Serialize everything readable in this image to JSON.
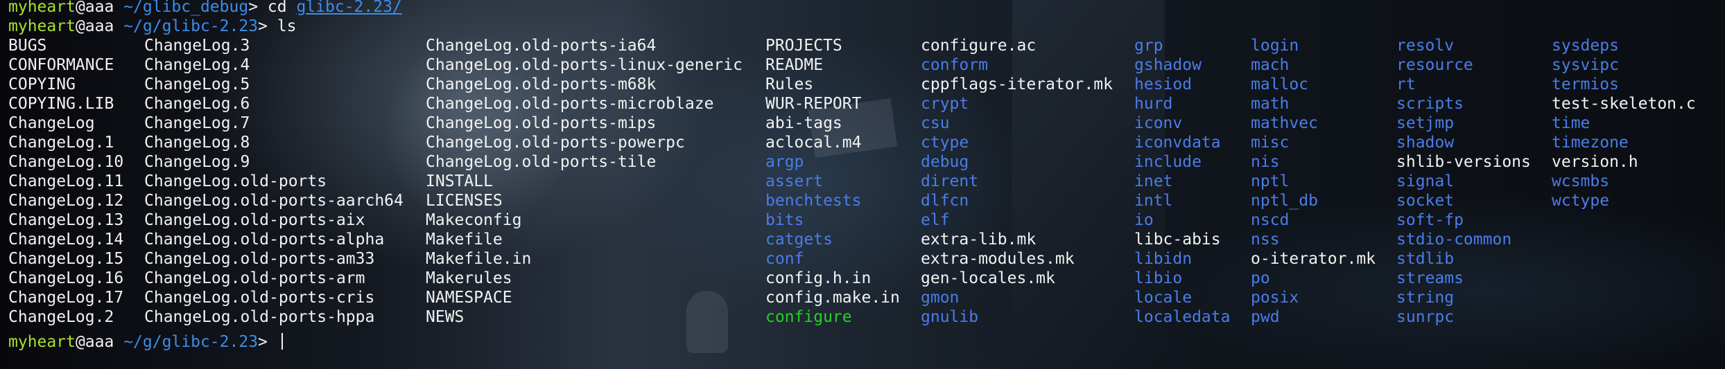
{
  "terminal": {
    "prompt_line_1": {
      "user": "myheart",
      "at": "@aaa",
      "path": " ~/glibc_debug",
      "symbol": "> ",
      "command": "cd ",
      "argument": "glibc-2.23/"
    },
    "prompt_line_2": {
      "user": "myheart",
      "at": "@aaa",
      "path": " ~/g/glibc-2.23",
      "symbol": "> ",
      "command": "ls"
    },
    "prompt_line_3": {
      "user": "myheart",
      "at": "@aaa",
      "path": " ~/g/glibc-2.23",
      "symbol": "> "
    },
    "colors": {
      "user": "#a6e22e",
      "path": "#3b8eea",
      "file": "#f2f2f2",
      "directory": "#4a7de8",
      "executable": "#23d123"
    },
    "listing_columns": [
      [
        {
          "name": "BUGS",
          "type": "file"
        },
        {
          "name": "CONFORMANCE",
          "type": "file"
        },
        {
          "name": "COPYING",
          "type": "file"
        },
        {
          "name": "COPYING.LIB",
          "type": "file"
        },
        {
          "name": "ChangeLog",
          "type": "file"
        },
        {
          "name": "ChangeLog.1",
          "type": "file"
        },
        {
          "name": "ChangeLog.10",
          "type": "file"
        },
        {
          "name": "ChangeLog.11",
          "type": "file"
        },
        {
          "name": "ChangeLog.12",
          "type": "file"
        },
        {
          "name": "ChangeLog.13",
          "type": "file"
        },
        {
          "name": "ChangeLog.14",
          "type": "file"
        },
        {
          "name": "ChangeLog.15",
          "type": "file"
        },
        {
          "name": "ChangeLog.16",
          "type": "file"
        },
        {
          "name": "ChangeLog.17",
          "type": "file"
        },
        {
          "name": "ChangeLog.2",
          "type": "file"
        }
      ],
      [
        {
          "name": "ChangeLog.3",
          "type": "file"
        },
        {
          "name": "ChangeLog.4",
          "type": "file"
        },
        {
          "name": "ChangeLog.5",
          "type": "file"
        },
        {
          "name": "ChangeLog.6",
          "type": "file"
        },
        {
          "name": "ChangeLog.7",
          "type": "file"
        },
        {
          "name": "ChangeLog.8",
          "type": "file"
        },
        {
          "name": "ChangeLog.9",
          "type": "file"
        },
        {
          "name": "ChangeLog.old-ports",
          "type": "file"
        },
        {
          "name": "ChangeLog.old-ports-aarch64",
          "type": "file"
        },
        {
          "name": "ChangeLog.old-ports-aix",
          "type": "file"
        },
        {
          "name": "ChangeLog.old-ports-alpha",
          "type": "file"
        },
        {
          "name": "ChangeLog.old-ports-am33",
          "type": "file"
        },
        {
          "name": "ChangeLog.old-ports-arm",
          "type": "file"
        },
        {
          "name": "ChangeLog.old-ports-cris",
          "type": "file"
        },
        {
          "name": "ChangeLog.old-ports-hppa",
          "type": "file"
        }
      ],
      [
        {
          "name": "ChangeLog.old-ports-ia64",
          "type": "file"
        },
        {
          "name": "ChangeLog.old-ports-linux-generic",
          "type": "file"
        },
        {
          "name": "ChangeLog.old-ports-m68k",
          "type": "file"
        },
        {
          "name": "ChangeLog.old-ports-microblaze",
          "type": "file"
        },
        {
          "name": "ChangeLog.old-ports-mips",
          "type": "file"
        },
        {
          "name": "ChangeLog.old-ports-powerpc",
          "type": "file"
        },
        {
          "name": "ChangeLog.old-ports-tile",
          "type": "file"
        },
        {
          "name": "INSTALL",
          "type": "file"
        },
        {
          "name": "LICENSES",
          "type": "file"
        },
        {
          "name": "Makeconfig",
          "type": "file"
        },
        {
          "name": "Makefile",
          "type": "file"
        },
        {
          "name": "Makefile.in",
          "type": "file"
        },
        {
          "name": "Makerules",
          "type": "file"
        },
        {
          "name": "NAMESPACE",
          "type": "file"
        },
        {
          "name": "NEWS",
          "type": "file"
        }
      ],
      [
        {
          "name": "PROJECTS",
          "type": "file"
        },
        {
          "name": "README",
          "type": "file"
        },
        {
          "name": "Rules",
          "type": "file"
        },
        {
          "name": "WUR-REPORT",
          "type": "file"
        },
        {
          "name": "abi-tags",
          "type": "file"
        },
        {
          "name": "aclocal.m4",
          "type": "file"
        },
        {
          "name": "argp",
          "type": "dir"
        },
        {
          "name": "assert",
          "type": "dir"
        },
        {
          "name": "benchtests",
          "type": "dir"
        },
        {
          "name": "bits",
          "type": "dir"
        },
        {
          "name": "catgets",
          "type": "dir"
        },
        {
          "name": "conf",
          "type": "dir"
        },
        {
          "name": "config.h.in",
          "type": "file"
        },
        {
          "name": "config.make.in",
          "type": "file"
        },
        {
          "name": "configure",
          "type": "exec"
        }
      ],
      [
        {
          "name": "configure.ac",
          "type": "file"
        },
        {
          "name": "conform",
          "type": "dir"
        },
        {
          "name": "cppflags-iterator.mk",
          "type": "file"
        },
        {
          "name": "crypt",
          "type": "dir"
        },
        {
          "name": "csu",
          "type": "dir"
        },
        {
          "name": "ctype",
          "type": "dir"
        },
        {
          "name": "debug",
          "type": "dir"
        },
        {
          "name": "dirent",
          "type": "dir"
        },
        {
          "name": "dlfcn",
          "type": "dir"
        },
        {
          "name": "elf",
          "type": "dir"
        },
        {
          "name": "extra-lib.mk",
          "type": "file"
        },
        {
          "name": "extra-modules.mk",
          "type": "file"
        },
        {
          "name": "gen-locales.mk",
          "type": "file"
        },
        {
          "name": "gmon",
          "type": "dir"
        },
        {
          "name": "gnulib",
          "type": "dir"
        }
      ],
      [
        {
          "name": "grp",
          "type": "dir"
        },
        {
          "name": "gshadow",
          "type": "dir"
        },
        {
          "name": "hesiod",
          "type": "dir"
        },
        {
          "name": "hurd",
          "type": "dir"
        },
        {
          "name": "iconv",
          "type": "dir"
        },
        {
          "name": "iconvdata",
          "type": "dir"
        },
        {
          "name": "include",
          "type": "dir"
        },
        {
          "name": "inet",
          "type": "dir"
        },
        {
          "name": "intl",
          "type": "dir"
        },
        {
          "name": "io",
          "type": "dir"
        },
        {
          "name": "libc-abis",
          "type": "file"
        },
        {
          "name": "libidn",
          "type": "dir"
        },
        {
          "name": "libio",
          "type": "dir"
        },
        {
          "name": "locale",
          "type": "dir"
        },
        {
          "name": "localedata",
          "type": "dir"
        }
      ],
      [
        {
          "name": "login",
          "type": "dir"
        },
        {
          "name": "mach",
          "type": "dir"
        },
        {
          "name": "malloc",
          "type": "dir"
        },
        {
          "name": "math",
          "type": "dir"
        },
        {
          "name": "mathvec",
          "type": "dir"
        },
        {
          "name": "misc",
          "type": "dir"
        },
        {
          "name": "nis",
          "type": "dir"
        },
        {
          "name": "nptl",
          "type": "dir"
        },
        {
          "name": "nptl_db",
          "type": "dir"
        },
        {
          "name": "nscd",
          "type": "dir"
        },
        {
          "name": "nss",
          "type": "dir"
        },
        {
          "name": "o-iterator.mk",
          "type": "file"
        },
        {
          "name": "po",
          "type": "dir"
        },
        {
          "name": "posix",
          "type": "dir"
        },
        {
          "name": "pwd",
          "type": "dir"
        }
      ],
      [
        {
          "name": "resolv",
          "type": "dir"
        },
        {
          "name": "resource",
          "type": "dir"
        },
        {
          "name": "rt",
          "type": "dir"
        },
        {
          "name": "scripts",
          "type": "dir"
        },
        {
          "name": "setjmp",
          "type": "dir"
        },
        {
          "name": "shadow",
          "type": "dir"
        },
        {
          "name": "shlib-versions",
          "type": "file"
        },
        {
          "name": "signal",
          "type": "dir"
        },
        {
          "name": "socket",
          "type": "dir"
        },
        {
          "name": "soft-fp",
          "type": "dir"
        },
        {
          "name": "stdio-common",
          "type": "dir"
        },
        {
          "name": "stdlib",
          "type": "dir"
        },
        {
          "name": "streams",
          "type": "dir"
        },
        {
          "name": "string",
          "type": "dir"
        },
        {
          "name": "sunrpc",
          "type": "dir"
        }
      ],
      [
        {
          "name": "sysdeps",
          "type": "dir"
        },
        {
          "name": "sysvipc",
          "type": "dir"
        },
        {
          "name": "termios",
          "type": "dir"
        },
        {
          "name": "test-skeleton.c",
          "type": "file"
        },
        {
          "name": "time",
          "type": "dir"
        },
        {
          "name": "timezone",
          "type": "dir"
        },
        {
          "name": "version.h",
          "type": "file"
        },
        {
          "name": "wcsmbs",
          "type": "dir"
        },
        {
          "name": "wctype",
          "type": "dir"
        }
      ]
    ]
  }
}
